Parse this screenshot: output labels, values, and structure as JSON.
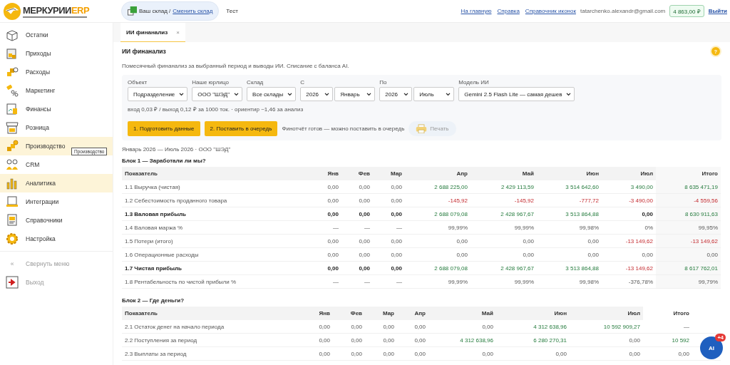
{
  "logo": {
    "name": "МЕРКУРИИ",
    "suffix": "ERP"
  },
  "warehouse": {
    "label": "Ваш склад /",
    "link": "Сменить склад"
  },
  "company": "Тест",
  "top_links": [
    "На главную",
    "Справка",
    "Справочник иконок"
  ],
  "email": "tatarchenko.alexandr@gmail.com",
  "balance": "4 863,00 ₽",
  "logout": "Выйти",
  "sidebar": {
    "items": [
      {
        "label": "Остатки",
        "highlighted": false
      },
      {
        "label": "Приходы",
        "highlighted": false
      },
      {
        "label": "Расходы",
        "highlighted": false
      },
      {
        "label": "Маркетинг",
        "highlighted": false
      },
      {
        "label": "Финансы",
        "highlighted": false
      },
      {
        "label": "Розница",
        "highlighted": false
      },
      {
        "label": "Производство",
        "highlighted": true,
        "tooltip": "Производство"
      },
      {
        "label": "CRM",
        "highlighted": false
      },
      {
        "label": "Аналитика",
        "highlighted": true
      },
      {
        "label": "Интеграции",
        "highlighted": false
      },
      {
        "label": "Справочники",
        "highlighted": false
      },
      {
        "label": "Настройка",
        "highlighted": false
      }
    ],
    "collapse": {
      "glyph": "«",
      "label": "Свернуть меню"
    },
    "exit": "Выход"
  },
  "tabs": [
    {
      "label": "ИИ финанализ",
      "selected": true,
      "close": "×"
    }
  ],
  "title": "ИИ финанализ",
  "help": "?",
  "description": "Помесячный финанализ за выбранный период и выводы ИИ. Списание с баланса AI.",
  "filters": [
    {
      "label": "Объект",
      "selects": [
        "Подразделение"
      ]
    },
    {
      "label": "Наше юрлицо",
      "selects": [
        "ООО \"ШЭД\""
      ]
    },
    {
      "label": "Склад",
      "selects": [
        "Все склады"
      ]
    },
    {
      "label": "С",
      "selects": [
        "2026",
        "Январь"
      ]
    },
    {
      "label": "По",
      "selects": [
        "2026",
        "Июль"
      ]
    },
    {
      "label": "Модель ИИ",
      "selects": [
        "Gemini 2.5 Flash Lite — самая дешев"
      ]
    }
  ],
  "pricing": "вход 0,03 ₽ / выход 0,12 ₽ за 1000 ток. · ориентир ~1,46 за анализ",
  "actions": [
    {
      "label": "1. Подготовить данные",
      "disabled": false
    },
    {
      "label": "2. Поставить в очередь",
      "disabled": false
    }
  ],
  "status": "Финотчёт готов — можно поставить в очередь",
  "print": {
    "label": "Печать",
    "disabled": true
  },
  "period": "Январь 2026 — Июль 2026 · ООО \"ШЭД\"",
  "blocks": [
    {
      "title": "Блок 1 — Заработали ли мы?",
      "columns": [
        "Показатель",
        "Янв",
        "Фев",
        "Мар",
        "Апр",
        "Май",
        "Июн",
        "Июл",
        "Итого"
      ],
      "rows": [
        {
          "label": "1.1 Выручка (чистая)",
          "bold": false,
          "values": [
            {
              "text": "0,00",
              "positive": false,
              "negative": false
            },
            {
              "text": "0,00",
              "positive": false,
              "negative": false
            },
            {
              "text": "0,00",
              "positive": false,
              "negative": false
            },
            {
              "text": "2 688 225,00",
              "positive": true,
              "negative": false
            },
            {
              "text": "2 429 113,59",
              "positive": true,
              "negative": false
            },
            {
              "text": "3 514 642,60",
              "positive": true,
              "negative": false
            },
            {
              "text": "3 490,00",
              "positive": true,
              "negative": false
            },
            {
              "text": "8 635 471,19",
              "positive": true,
              "negative": false
            }
          ]
        },
        {
          "label": "1.2 Себестоимость проданного товара",
          "bold": false,
          "values": [
            {
              "text": "0,00",
              "positive": false,
              "negative": false
            },
            {
              "text": "0,00",
              "positive": false,
              "negative": false
            },
            {
              "text": "0,00",
              "positive": false,
              "negative": false
            },
            {
              "text": "-145,92",
              "positive": false,
              "negative": true
            },
            {
              "text": "-145,92",
              "positive": false,
              "negative": true
            },
            {
              "text": "-777,72",
              "positive": false,
              "negative": true
            },
            {
              "text": "-3 490,00",
              "positive": false,
              "negative": true
            },
            {
              "text": "-4 559,56",
              "positive": false,
              "negative": true
            }
          ]
        },
        {
          "label": "1.3 Валовая прибыль",
          "bold": true,
          "values": [
            {
              "text": "0,00",
              "positive": false,
              "negative": false
            },
            {
              "text": "0,00",
              "positive": false,
              "negative": false
            },
            {
              "text": "0,00",
              "positive": false,
              "negative": false
            },
            {
              "text": "2 688 079,08",
              "positive": true,
              "negative": false
            },
            {
              "text": "2 428 967,67",
              "positive": true,
              "negative": false
            },
            {
              "text": "3 513 864,88",
              "positive": true,
              "negative": false
            },
            {
              "text": "0,00",
              "positive": false,
              "negative": false
            },
            {
              "text": "8 630 911,63",
              "positive": true,
              "negative": false
            }
          ]
        },
        {
          "label": "1.4 Валовая маржа %",
          "bold": false,
          "values": [
            {
              "text": "—",
              "positive": false,
              "negative": false
            },
            {
              "text": "—",
              "positive": false,
              "negative": false
            },
            {
              "text": "—",
              "positive": false,
              "negative": false
            },
            {
              "text": "99,99%",
              "positive": false,
              "negative": false
            },
            {
              "text": "99,99%",
              "positive": false,
              "negative": false
            },
            {
              "text": "99,98%",
              "positive": false,
              "negative": false
            },
            {
              "text": "0%",
              "positive": false,
              "negative": false
            },
            {
              "text": "99,95%",
              "positive": false,
              "negative": false
            }
          ]
        },
        {
          "label": "1.5 Потери (итого)",
          "bold": false,
          "values": [
            {
              "text": "0,00",
              "positive": false,
              "negative": false
            },
            {
              "text": "0,00",
              "positive": false,
              "negative": false
            },
            {
              "text": "0,00",
              "positive": false,
              "negative": false
            },
            {
              "text": "0,00",
              "positive": false,
              "negative": false
            },
            {
              "text": "0,00",
              "positive": false,
              "negative": false
            },
            {
              "text": "0,00",
              "positive": false,
              "negative": false
            },
            {
              "text": "-13 149,62",
              "positive": false,
              "negative": true
            },
            {
              "text": "-13 149,62",
              "positive": false,
              "negative": true
            }
          ]
        },
        {
          "label": "1.6 Операционные расходы",
          "bold": false,
          "values": [
            {
              "text": "0,00",
              "positive": false,
              "negative": false
            },
            {
              "text": "0,00",
              "positive": false,
              "negative": false
            },
            {
              "text": "0,00",
              "positive": false,
              "negative": false
            },
            {
              "text": "0,00",
              "positive": false,
              "negative": false
            },
            {
              "text": "0,00",
              "positive": false,
              "negative": false
            },
            {
              "text": "0,00",
              "positive": false,
              "negative": false
            },
            {
              "text": "0,00",
              "positive": false,
              "negative": false
            },
            {
              "text": "0,00",
              "positive": false,
              "negative": false
            }
          ]
        },
        {
          "label": "1.7 Чистая прибыль",
          "bold": true,
          "values": [
            {
              "text": "0,00",
              "positive": false,
              "negative": false
            },
            {
              "text": "0,00",
              "positive": false,
              "negative": false
            },
            {
              "text": "0,00",
              "positive": false,
              "negative": false
            },
            {
              "text": "2 688 079,08",
              "positive": true,
              "negative": false
            },
            {
              "text": "2 428 967,67",
              "positive": true,
              "negative": false
            },
            {
              "text": "3 513 864,88",
              "positive": true,
              "negative": false
            },
            {
              "text": "-13 149,62",
              "positive": false,
              "negative": true
            },
            {
              "text": "8 617 762,01",
              "positive": true,
              "negative": false
            }
          ]
        },
        {
          "label": "1.8 Рентабельность по чистой прибыли %",
          "bold": false,
          "values": [
            {
              "text": "—",
              "positive": false,
              "negative": false
            },
            {
              "text": "—",
              "positive": false,
              "negative": false
            },
            {
              "text": "—",
              "positive": false,
              "negative": false
            },
            {
              "text": "99,99%",
              "positive": false,
              "negative": false
            },
            {
              "text": "99,99%",
              "positive": false,
              "negative": false
            },
            {
              "text": "99,98%",
              "positive": false,
              "negative": false
            },
            {
              "text": "-376,78%",
              "positive": false,
              "negative": false
            },
            {
              "text": "99,79%",
              "positive": false,
              "negative": false
            }
          ]
        }
      ]
    },
    {
      "title": "Блок 2 — Где деньги?",
      "columns": [
        "Показатель",
        "Янв",
        "Фев",
        "Мар",
        "Апр",
        "Май",
        "Июн",
        "Июл",
        "Итого"
      ],
      "rows": [
        {
          "label": "2.1 Остаток денег на начало периода",
          "bold": false,
          "values": [
            {
              "text": "0,00",
              "positive": false,
              "negative": false
            },
            {
              "text": "0,00",
              "positive": false,
              "negative": false
            },
            {
              "text": "0,00",
              "positive": false,
              "negative": false
            },
            {
              "text": "0,00",
              "positive": false,
              "negative": false
            },
            {
              "text": "0,00",
              "positive": false,
              "negative": false
            },
            {
              "text": "4 312 638,96",
              "positive": true,
              "negative": false
            },
            {
              "text": "10 592 909,27",
              "positive": true,
              "negative": false
            },
            {
              "text": "—",
              "positive": false,
              "negative": false
            }
          ]
        },
        {
          "label": "2.2 Поступления за период",
          "bold": false,
          "values": [
            {
              "text": "0,00",
              "positive": false,
              "negative": false
            },
            {
              "text": "0,00",
              "positive": false,
              "negative": false
            },
            {
              "text": "0,00",
              "positive": false,
              "negative": false
            },
            {
              "text": "0,00",
              "positive": false,
              "negative": false
            },
            {
              "text": "4 312 638,96",
              "positive": true,
              "negative": false
            },
            {
              "text": "6 280 270,31",
              "positive": true,
              "negative": false
            },
            {
              "text": "0,00",
              "positive": false,
              "negative": false
            },
            {
              "text": "10 592",
              "positive": true,
              "negative": false
            }
          ]
        },
        {
          "label": "2.3 Выплаты за период",
          "bold": false,
          "values": [
            {
              "text": "0,00",
              "positive": false,
              "negative": false
            },
            {
              "text": "0,00",
              "positive": false,
              "negative": false
            },
            {
              "text": "0,00",
              "positive": false,
              "negative": false
            },
            {
              "text": "0,00",
              "positive": false,
              "negative": false
            },
            {
              "text": "0,00",
              "positive": false,
              "negative": false
            },
            {
              "text": "0,00",
              "positive": false,
              "negative": false
            },
            {
              "text": "0,00",
              "positive": false,
              "negative": false
            },
            {
              "text": "0,00",
              "positive": false,
              "negative": false
            }
          ]
        }
      ]
    }
  ],
  "ai_button": {
    "label": "AI",
    "badge": "+4"
  }
}
